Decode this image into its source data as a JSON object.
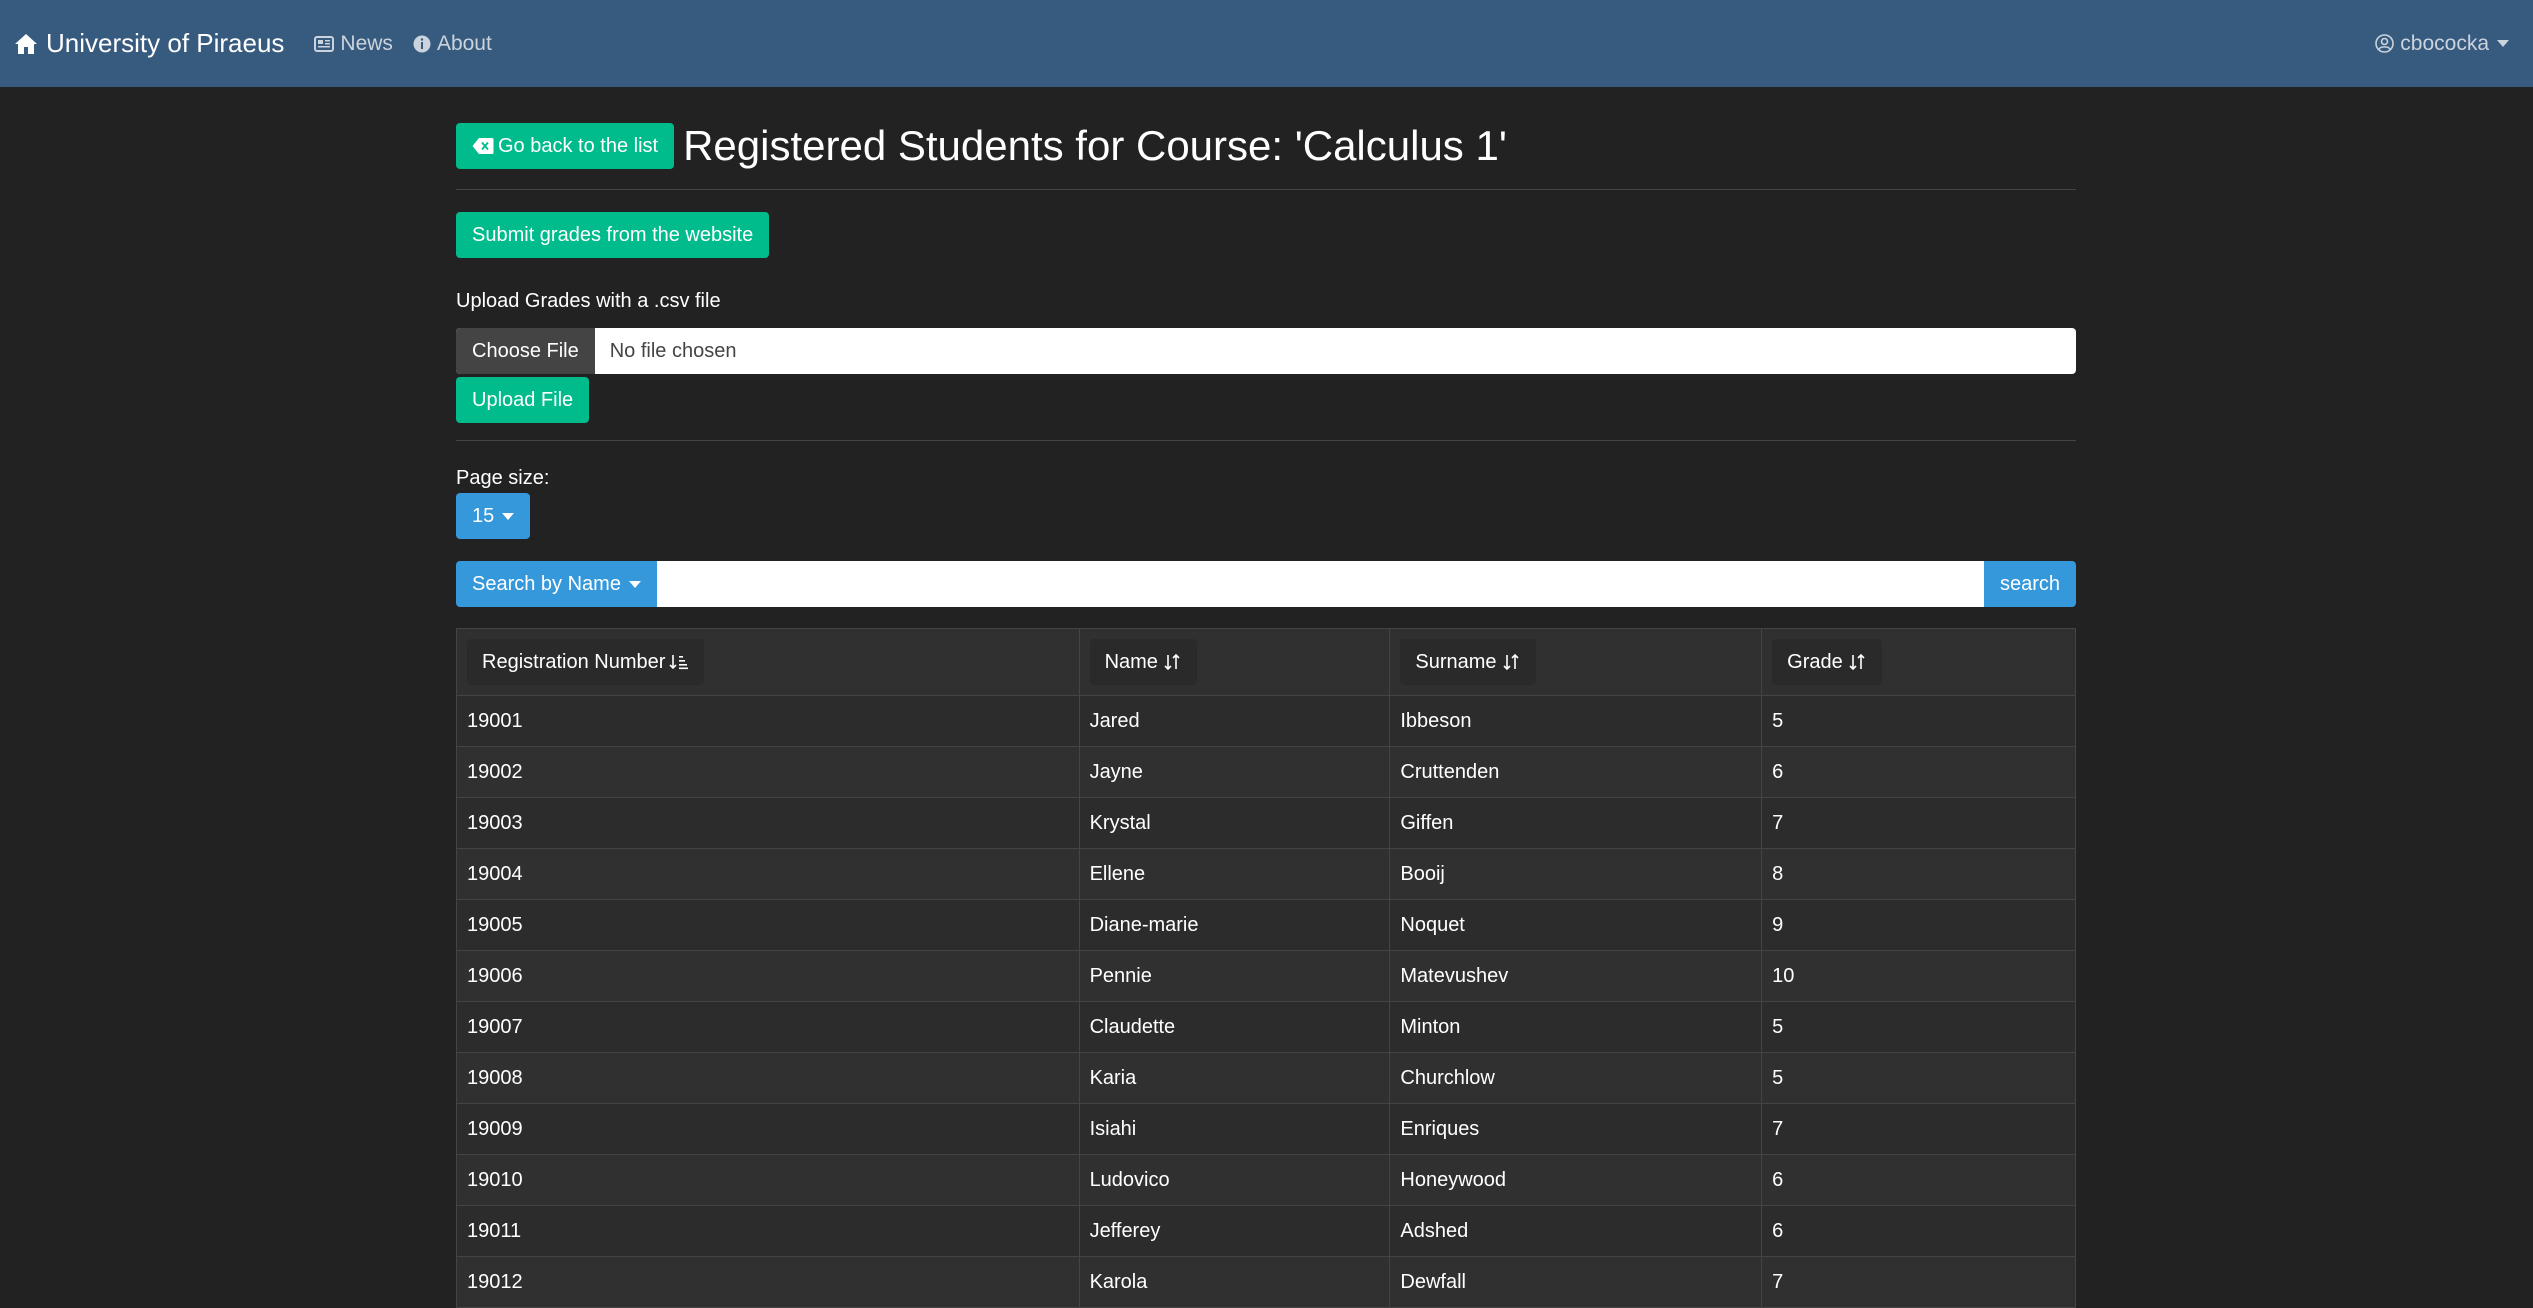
{
  "navbar": {
    "brand": "University of Piraeus",
    "links": [
      {
        "label": "News",
        "icon": "newspaper-icon"
      },
      {
        "label": "About",
        "icon": "info-circle-icon"
      }
    ],
    "user": "cbococka"
  },
  "header": {
    "back_button": "Go back to the list",
    "title": "Registered Students for Course: 'Calculus 1'"
  },
  "actions": {
    "submit_button": "Submit grades from the website",
    "upload_label": "Upload Grades with a .csv file",
    "choose_file": "Choose File",
    "no_file": "No file chosen",
    "upload_button": "Upload File"
  },
  "pagination": {
    "label": "Page size:",
    "value": "15"
  },
  "search": {
    "mode": "Search by Name",
    "placeholder": "",
    "button": "search"
  },
  "table": {
    "columns": [
      "Registration Number",
      "Name",
      "Surname",
      "Grade"
    ],
    "rows": [
      [
        "19001",
        "Jared",
        "Ibbeson",
        "5"
      ],
      [
        "19002",
        "Jayne",
        "Cruttenden",
        "6"
      ],
      [
        "19003",
        "Krystal",
        "Giffen",
        "7"
      ],
      [
        "19004",
        "Ellene",
        "Booij",
        "8"
      ],
      [
        "19005",
        "Diane-marie",
        "Noquet",
        "9"
      ],
      [
        "19006",
        "Pennie",
        "Matevushev",
        "10"
      ],
      [
        "19007",
        "Claudette",
        "Minton",
        "5"
      ],
      [
        "19008",
        "Karia",
        "Churchlow",
        "5"
      ],
      [
        "19009",
        "Isiahi",
        "Enriques",
        "7"
      ],
      [
        "19010",
        "Ludovico",
        "Honeywood",
        "6"
      ],
      [
        "19011",
        "Jefferey",
        "Adshed",
        "6"
      ],
      [
        "19012",
        "Karola",
        "Dewfall",
        "7"
      ]
    ]
  },
  "colors": {
    "navbar": "#375a7f",
    "background": "#222222",
    "success": "#00bc8c",
    "primary": "#3498db"
  }
}
